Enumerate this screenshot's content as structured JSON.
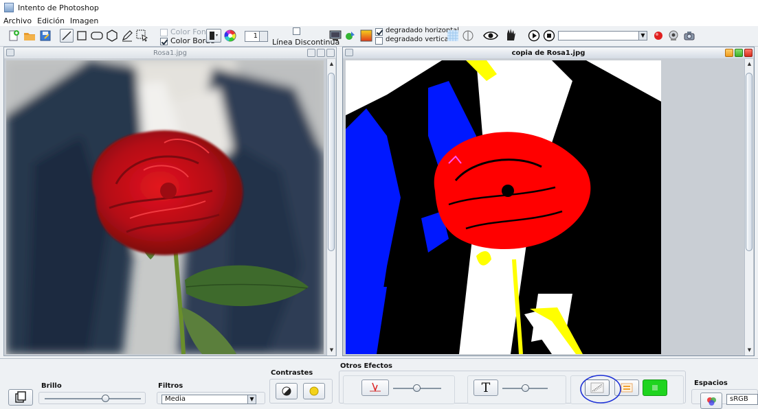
{
  "window": {
    "title": "Intento de Photoshop"
  },
  "menu": {
    "items": [
      "Archivo",
      "Edición",
      "Imagen"
    ]
  },
  "toolbar": {
    "color_fondo_label": "Color Fondo",
    "color_borde_label": "Color Borde",
    "color_fondo_checked": false,
    "color_borde_checked": true,
    "stroke_width_value": "1",
    "linea_discontinua_label": "Línea Discontinua",
    "linea_discontinua_checked": false,
    "degradado_horizontal_label": "degradado horizontal",
    "degradado_horizontal_checked": true,
    "degradado_vertical_label": "degradado vertical",
    "degradado_vertical_checked": false
  },
  "frames": {
    "left": {
      "title": "Rosa1.jpg",
      "active": false
    },
    "right": {
      "title": "copia de Rosa1.jpg",
      "active": true
    }
  },
  "panels": {
    "brillo": {
      "title": "Brillo",
      "level": 0.58
    },
    "filtros": {
      "title": "Filtros",
      "selected": "Media"
    },
    "contrastes": {
      "title": "Contrastes"
    },
    "otros": {
      "title": "Otros Efectos",
      "slider1": 0.45,
      "slider2": 0.5
    },
    "espacios": {
      "title": "Espacios",
      "selected": "sRGB"
    }
  },
  "colors": {
    "accent_annotation": "#1b2fd6",
    "record": "#e02020",
    "green_button": "#1fd41f",
    "sepia_icon": "#f0a030"
  }
}
